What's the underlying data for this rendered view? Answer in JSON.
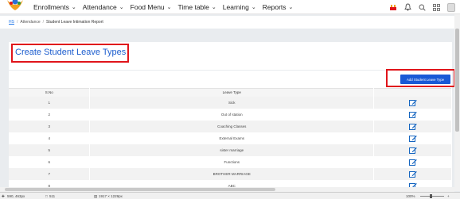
{
  "nav": {
    "items": [
      {
        "label": "Enrollments"
      },
      {
        "label": "Attendance"
      },
      {
        "label": "Food Menu"
      },
      {
        "label": "Time table"
      },
      {
        "label": "Learning"
      },
      {
        "label": "Reports"
      }
    ]
  },
  "breadcrumb": {
    "home": "HS",
    "section": "Attendance",
    "current": "Student Leave Intimation Report"
  },
  "page": {
    "title": "Create Student Leave Types",
    "add_button": "Add Student Leave Type"
  },
  "table": {
    "headers": [
      "S.No",
      "Leave Type",
      ""
    ],
    "rows": [
      {
        "sno": "1",
        "type": "Sick"
      },
      {
        "sno": "2",
        "type": "Out of station"
      },
      {
        "sno": "3",
        "type": "Coaching Classes"
      },
      {
        "sno": "4",
        "type": "External Exams"
      },
      {
        "sno": "5",
        "type": "sister marriage"
      },
      {
        "sno": "6",
        "type": "Functions"
      },
      {
        "sno": "7",
        "type": "BROTHER MARRIAGE"
      },
      {
        "sno": "8",
        "type": "ABC"
      }
    ]
  },
  "statusbar": {
    "coords": "590, 463px",
    "selection": "511",
    "size": "1917 × 1229px",
    "zoom": "100%"
  },
  "colors": {
    "accent": "#1c5dce",
    "button": "#1959d6",
    "highlight_box": "#e0141a",
    "edit_icon": "#1565c0"
  }
}
